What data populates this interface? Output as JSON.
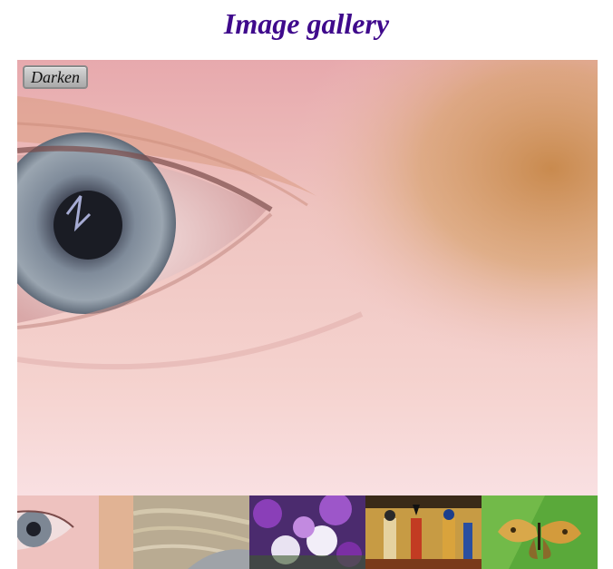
{
  "page": {
    "title": "Image gallery",
    "title_color": "#3f0a8c"
  },
  "main_image": {
    "subject": "close-up-eye",
    "darken_button_label": "Darken"
  },
  "thumbnails": [
    {
      "subject": "close-up-eye"
    },
    {
      "subject": "rock-texture"
    },
    {
      "subject": "purple-white-flowers"
    },
    {
      "subject": "egyptian-wall-painting"
    },
    {
      "subject": "butterfly-on-leaf"
    }
  ]
}
